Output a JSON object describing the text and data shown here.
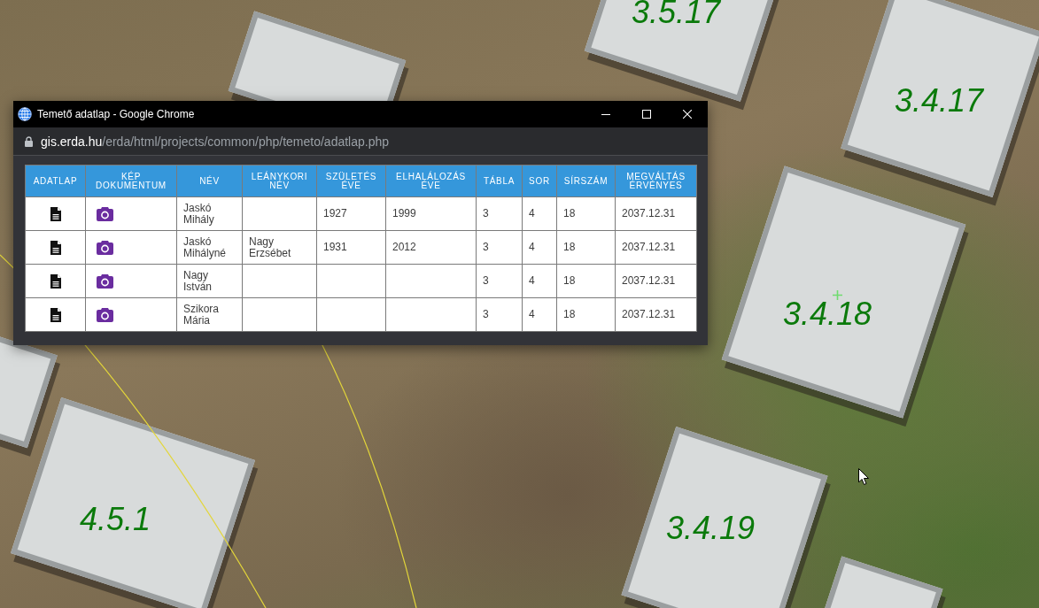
{
  "map": {
    "plot_labels": [
      "3.5.17",
      "3.4.17",
      "3.4.18",
      "4.5.1",
      "3.4.19"
    ]
  },
  "window": {
    "title": "Temető adatlap - Google Chrome",
    "address": {
      "host": "gis.erda.hu",
      "path": "/erda/html/projects/common/php/temeto/adatlap.php"
    }
  },
  "table": {
    "columns": [
      "ADATLAP",
      "KÉP DOKUMENTUM",
      "NÉV",
      "LEÁNYKORI NÉV",
      "SZÜLETÉS ÉVE",
      "ELHALÁLOZÁS ÉVE",
      "TÁBLA",
      "SOR",
      "SÍRSZÁM",
      "MEGVÁLTÁS ÉRVÉNYES"
    ],
    "rows": [
      {
        "name": "Jaskó Mihály",
        "birth_year": "1927",
        "death_year": "1999",
        "plot": "3",
        "row": "4",
        "grave_no": "18",
        "valid_until": "2037.12.31"
      },
      {
        "name": "Jaskó Mihályné",
        "maiden_name": "Nagy Erzsébet",
        "birth_year": "1931",
        "death_year": "2012",
        "plot": "3",
        "row": "4",
        "grave_no": "18",
        "valid_until": "2037.12.31"
      },
      {
        "name": "Nagy István",
        "plot": "3",
        "row": "4",
        "grave_no": "18",
        "valid_until": "2037.12.31"
      },
      {
        "name": "Szikora Mária",
        "plot": "3",
        "row": "4",
        "grave_no": "18",
        "valid_until": "2037.12.31"
      }
    ]
  }
}
